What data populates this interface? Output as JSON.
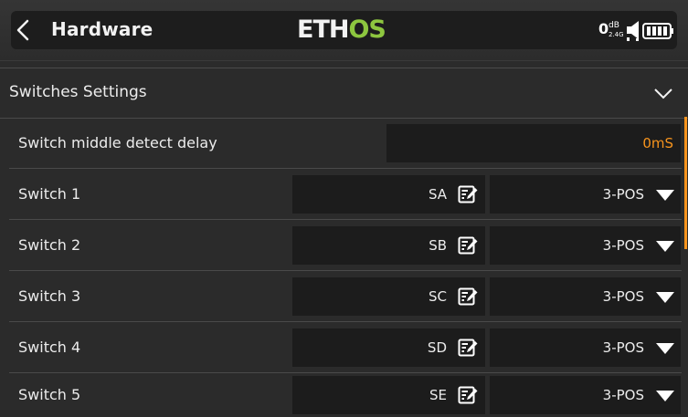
{
  "header": {
    "title": "Hardware",
    "logo_main": "ETH",
    "logo_accent": "OS",
    "rssi_value": "0",
    "rssi_unit": "dB",
    "rssi_band": "2.4G"
  },
  "section": {
    "label": "Switches Settings"
  },
  "settings": {
    "delay_label": "Switch middle detect delay",
    "delay_value": "0mS"
  },
  "switches": [
    {
      "label": "Switch 1",
      "name": "SA",
      "type": "3-POS"
    },
    {
      "label": "Switch 2",
      "name": "SB",
      "type": "3-POS"
    },
    {
      "label": "Switch 3",
      "name": "SC",
      "type": "3-POS"
    },
    {
      "label": "Switch 4",
      "name": "SD",
      "type": "3-POS"
    },
    {
      "label": "Switch 5",
      "name": "SE",
      "type": "3-POS"
    }
  ],
  "colors": {
    "accent": "#f7941d",
    "logo_green": "#8dc63f",
    "background": "#2b2b2b",
    "field": "#1c1c1c"
  },
  "icons": {
    "back": "chevron-left-icon",
    "speaker": "speaker-icon",
    "battery": "battery-icon",
    "expand": "chevron-down-icon",
    "edit": "edit-icon",
    "dropdown": "triangle-down-icon"
  }
}
